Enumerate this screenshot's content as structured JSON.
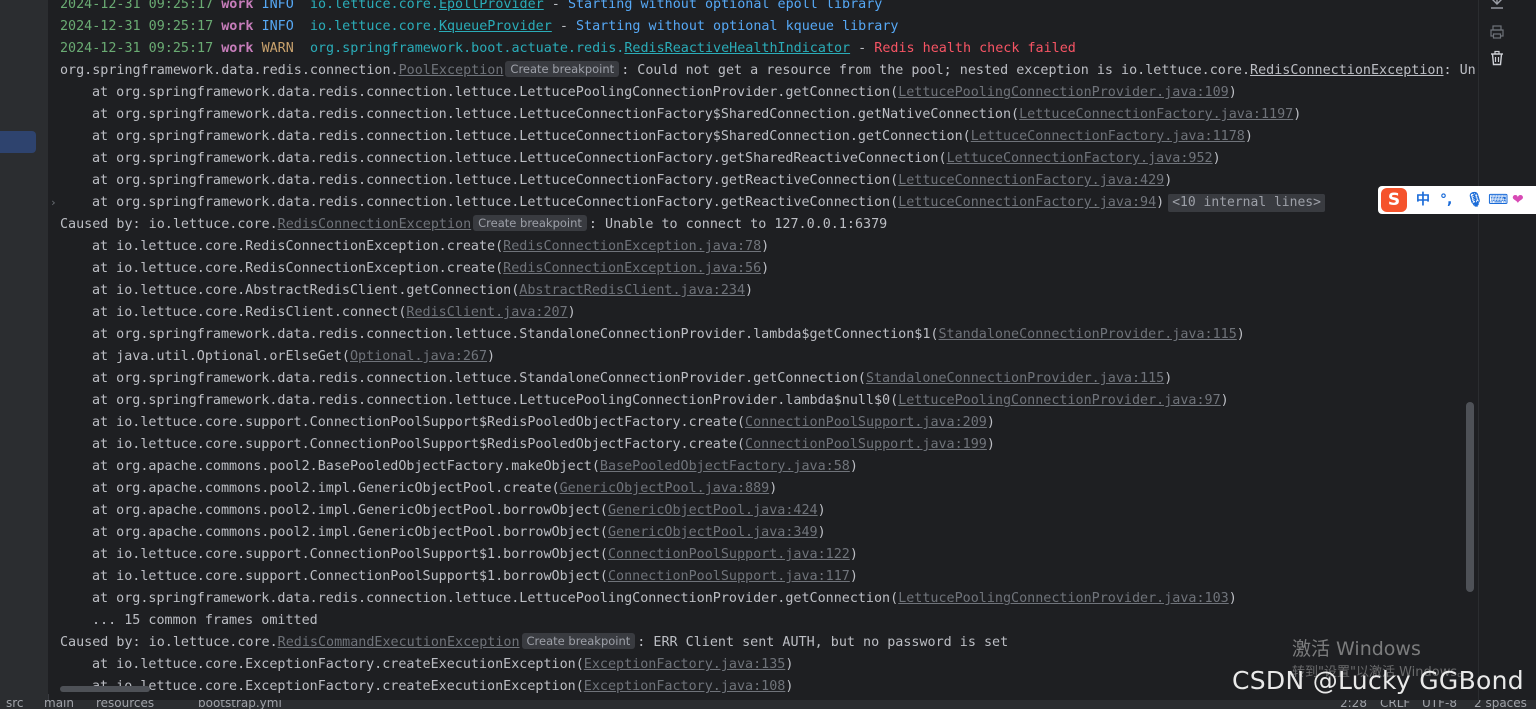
{
  "log": {
    "rows": [
      {
        "timestamp": "2024-12-31 09:25:17",
        "thread": "work",
        "level": "INFO",
        "logger_prefix": "io.lettuce.core.",
        "logger_class": "EpollProvider",
        "sep": " - ",
        "message": "Starting without optional epoll library"
      },
      {
        "timestamp": "2024-12-31 09:25:17",
        "thread": "work",
        "level": "INFO",
        "logger_prefix": "io.lettuce.core.",
        "logger_class": "KqueueProvider",
        "sep": " - ",
        "message": "Starting without optional kqueue library"
      },
      {
        "timestamp": "2024-12-31 09:25:17",
        "thread": "work",
        "level": "WARN",
        "logger_prefix": "org.springframework.boot.actuate.redis.",
        "logger_class": "RedisReactiveHealthIndicator",
        "sep": " - ",
        "message": "Redis health check failed"
      }
    ]
  },
  "exception1": {
    "prefix": "org.springframework.data.redis.connection.",
    "class": "PoolException",
    "breakpoint_label": "Create breakpoint",
    "msg_before": ": Could not get a resource from the pool; nested exception is io.lettuce.core.",
    "nested_class": "RedisConnectionException",
    "msg_after": ": Una",
    "frames": [
      {
        "text": "at org.springframework.data.redis.connection.lettuce.LettucePoolingConnectionProvider.getConnection(",
        "link": "LettucePoolingConnectionProvider.java:109",
        "close": ")"
      },
      {
        "text": "at org.springframework.data.redis.connection.lettuce.LettuceConnectionFactory$SharedConnection.getNativeConnection(",
        "link": "LettuceConnectionFactory.java:1197",
        "close": ")"
      },
      {
        "text": "at org.springframework.data.redis.connection.lettuce.LettuceConnectionFactory$SharedConnection.getConnection(",
        "link": "LettuceConnectionFactory.java:1178",
        "close": ")"
      },
      {
        "text": "at org.springframework.data.redis.connection.lettuce.LettuceConnectionFactory.getSharedReactiveConnection(",
        "link": "LettuceConnectionFactory.java:952",
        "close": ")"
      },
      {
        "text": "at org.springframework.data.redis.connection.lettuce.LettuceConnectionFactory.getReactiveConnection(",
        "link": "LettuceConnectionFactory.java:429",
        "close": ")"
      },
      {
        "text": "at org.springframework.data.redis.connection.lettuce.LettuceConnectionFactory.getReactiveConnection(",
        "link": "LettuceConnectionFactory.java:94",
        "close": ")"
      }
    ],
    "internal_lines": "<10 internal lines>"
  },
  "exception2": {
    "caused_by": "Caused by: io.lettuce.core.",
    "class": "RedisConnectionException",
    "breakpoint_label": "Create breakpoint",
    "message": ": Unable to connect to 127.0.0.1:6379",
    "frames": [
      {
        "text": "at io.lettuce.core.RedisConnectionException.create(",
        "link": "RedisConnectionException.java:78",
        "close": ")"
      },
      {
        "text": "at io.lettuce.core.RedisConnectionException.create(",
        "link": "RedisConnectionException.java:56",
        "close": ")"
      },
      {
        "text": "at io.lettuce.core.AbstractRedisClient.getConnection(",
        "link": "AbstractRedisClient.java:234",
        "close": ")"
      },
      {
        "text": "at io.lettuce.core.RedisClient.connect(",
        "link": "RedisClient.java:207",
        "close": ")"
      },
      {
        "text": "at org.springframework.data.redis.connection.lettuce.StandaloneConnectionProvider.lambda$getConnection$1(",
        "link": "StandaloneConnectionProvider.java:115",
        "close": ")"
      },
      {
        "text": "at java.util.Optional.orElseGet(",
        "link": "Optional.java:267",
        "close": ")"
      },
      {
        "text": "at org.springframework.data.redis.connection.lettuce.StandaloneConnectionProvider.getConnection(",
        "link": "StandaloneConnectionProvider.java:115",
        "close": ")"
      },
      {
        "text": "at org.springframework.data.redis.connection.lettuce.LettucePoolingConnectionProvider.lambda$null$0(",
        "link": "LettucePoolingConnectionProvider.java:97",
        "close": ")"
      },
      {
        "text": "at io.lettuce.core.support.ConnectionPoolSupport$RedisPooledObjectFactory.create(",
        "link": "ConnectionPoolSupport.java:209",
        "close": ")"
      },
      {
        "text": "at io.lettuce.core.support.ConnectionPoolSupport$RedisPooledObjectFactory.create(",
        "link": "ConnectionPoolSupport.java:199",
        "close": ")"
      },
      {
        "text": "at org.apache.commons.pool2.BasePooledObjectFactory.makeObject(",
        "link": "BasePooledObjectFactory.java:58",
        "close": ")"
      },
      {
        "text": "at org.apache.commons.pool2.impl.GenericObjectPool.create(",
        "link": "GenericObjectPool.java:889",
        "close": ")"
      },
      {
        "text": "at org.apache.commons.pool2.impl.GenericObjectPool.borrowObject(",
        "link": "GenericObjectPool.java:424",
        "close": ")"
      },
      {
        "text": "at org.apache.commons.pool2.impl.GenericObjectPool.borrowObject(",
        "link": "GenericObjectPool.java:349",
        "close": ")"
      },
      {
        "text": "at io.lettuce.core.support.ConnectionPoolSupport$1.borrowObject(",
        "link": "ConnectionPoolSupport.java:122",
        "close": ")"
      },
      {
        "text": "at io.lettuce.core.support.ConnectionPoolSupport$1.borrowObject(",
        "link": "ConnectionPoolSupport.java:117",
        "close": ")"
      },
      {
        "text": "at org.springframework.data.redis.connection.lettuce.LettucePoolingConnectionProvider.getConnection(",
        "link": "LettucePoolingConnectionProvider.java:103",
        "close": ")"
      }
    ],
    "omitted": "... 15 common frames omitted"
  },
  "exception3": {
    "caused_by": "Caused by: io.lettuce.core.",
    "class": "RedisCommandExecutionException",
    "breakpoint_label": "Create breakpoint",
    "message": ": ERR Client sent AUTH, but no password is set",
    "frames": [
      {
        "text": "at io.lettuce.core.ExceptionFactory.createExecutionException(",
        "link": "ExceptionFactory.java:135",
        "close": ")"
      },
      {
        "text": "at io.lettuce.core.ExceptionFactory.createExecutionException(",
        "link": "ExceptionFactory.java:108",
        "close": ")"
      }
    ]
  },
  "toolbar": {
    "icons": [
      "scroll-to-end-icon",
      "print-icon",
      "trash-icon"
    ]
  },
  "ime": {
    "logo": "S",
    "mode": "中",
    "punct": "°,",
    "mic": "🎙",
    "keyboard": "⌨",
    "skin": "❤"
  },
  "watermarks": {
    "activate_title": "激活 Windows",
    "activate_sub": "转到\"设置\"以激活 Windows。",
    "csdn": "CSDN @Lucky GGBond"
  },
  "statusbar": {
    "path": [
      "src",
      "main",
      "resources",
      "bootstrap.yml"
    ],
    "position": "2:28",
    "line_ending": "CRLF",
    "encoding": "UTF-8",
    "indent": "2 spaces"
  },
  "colors": {
    "background": "#1e1f22",
    "timestamp": "#6aab73",
    "thread": "#c77dbb",
    "info": "#56a8f5",
    "error_text": "#f75464",
    "logger": "#2aacb8"
  }
}
